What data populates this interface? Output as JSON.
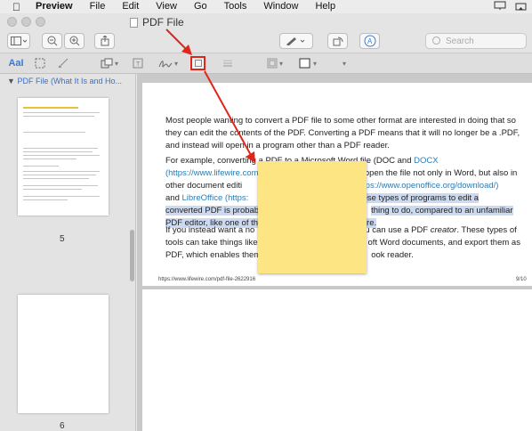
{
  "menubar": {
    "app": "Preview",
    "items": [
      "File",
      "Edit",
      "View",
      "Go",
      "Tools",
      "Window",
      "Help"
    ]
  },
  "window": {
    "title": "PDF File"
  },
  "toolbar": {
    "search_placeholder": "Search",
    "font_button": "AaI"
  },
  "sidebar": {
    "header": "PDF File (What It Is and Ho...",
    "pages": [
      "5",
      "6"
    ]
  },
  "document": {
    "p1": "Most people wanting to convert a PDF file to some other format are interested in doing that so they can edit the contents of the PDF. Converting a PDF means that it will no longer be a .PDF, and instead will open in a program other than a PDF reader.",
    "p2_a": "For example, converting a PDF to a Microsoft Word file (DOC and ",
    "p2_docx": "DOCX",
    "p2_link1": "(https://www.lifewire.com/docx-file-2620750)",
    "p2_b": " lets you open the file not only in Word, but also in other document editi",
    "p2_link2": "https://www.openoffice.org/download/)",
    "p2_c": "and ",
    "p2_libre": "LibreOffice",
    "p2_link3": " (https:",
    "p2_hl1": "hese types of programs to edit a",
    "p2_hl2": "converted PDF is probab",
    "p2_hl3": "thing to do, compared to an unfamiliar",
    "p2_hl4": "PDF editor, like one of th",
    "p2_hl5": "re.",
    "p3_a": "If you instead want a no",
    "p3_b": "u can use a PDF ",
    "p3_creator": "creator",
    "p3_c": ". These types of",
    "p3_d": "tools can take things like",
    "p3_e": "oft Word documents, and export them as",
    "p3_f": "PDF, which enables them",
    "p3_g": "ook reader.",
    "footer_url": "https://www.lifewire.com/pdf-file-2622916",
    "footer_page": "9/10"
  },
  "colors": {
    "accent": "#3b7ad8",
    "highlight": "#cbd9f1",
    "sticky_note": "#fde583",
    "callout": "#e0261b"
  }
}
